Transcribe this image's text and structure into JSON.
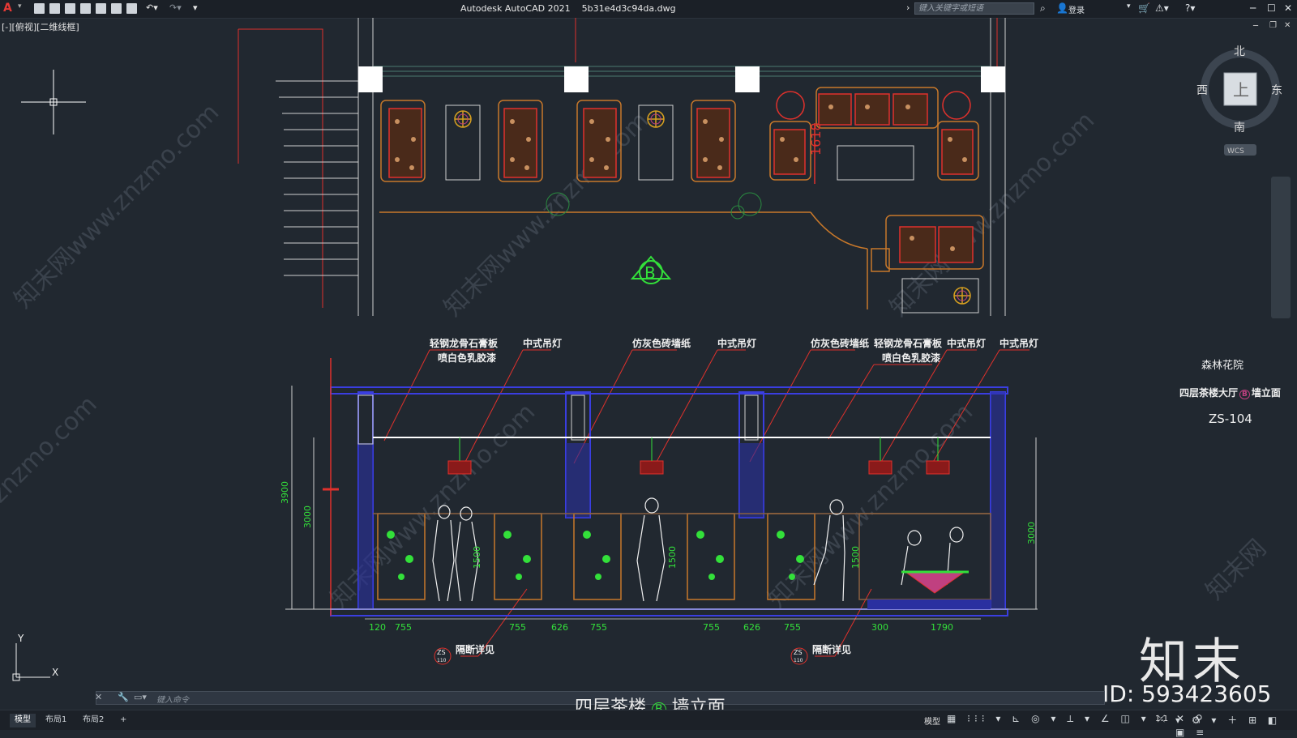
{
  "window": {
    "app_title": "Autodesk AutoCAD 2021",
    "file_name": "5b31e4d3c94da.dwg",
    "search_placeholder": "键入关键字或短语",
    "login_label": "登录"
  },
  "viewport": {
    "view_label": "[-][俯视][二维线框]"
  },
  "viewcube": {
    "north": "北",
    "south": "南",
    "east": "东",
    "west": "西",
    "face": "上",
    "wcs": "WCS"
  },
  "title_block": {
    "project": "森林花院",
    "sheet_title": "四层茶楼大厅",
    "sheet_suffix": "墙立面",
    "elevation_mark": "B",
    "sheet_no": "ZS-104"
  },
  "plan": {
    "elevation_marker": "B",
    "dimension": "1618"
  },
  "annotations": [
    {
      "text": "轻钢龙骨石膏板",
      "text2": "喷白色乳胶漆"
    },
    {
      "text": "中式吊灯"
    },
    {
      "text": "仿灰色砖墙纸"
    },
    {
      "text": "中式吊灯"
    },
    {
      "text": "仿灰色砖墙纸"
    },
    {
      "text": "轻钢龙骨石膏板",
      "text2": "喷白色乳胶漆"
    },
    {
      "text": "中式吊灯"
    },
    {
      "text": "中式吊灯"
    }
  ],
  "elevation": {
    "dim_left_outer": "3900",
    "dim_left_inner": "3000",
    "dim_right": "3000",
    "dim_1500_labels": [
      "1500",
      "1500",
      "1500"
    ],
    "bottom_dims": [
      "120",
      "755",
      "755",
      "626",
      "755",
      "755",
      "626",
      "755",
      "300",
      "1790"
    ],
    "detail_refs": [
      {
        "code": "ZS",
        "num": "110",
        "label": "隔断详见"
      },
      {
        "code": "ZS",
        "num": "110",
        "label": "隔断详见"
      }
    ],
    "drawing_title": "四层茶楼",
    "drawing_title_mark": "B",
    "drawing_title_suffix": "墙立面"
  },
  "ucs": {
    "x": "X",
    "y": "Y"
  },
  "command": {
    "placeholder": "键入命令"
  },
  "layout_tabs": [
    "模型",
    "布局1",
    "布局2",
    "+"
  ],
  "status": {
    "model_label": "模型",
    "scale": "1:1"
  },
  "watermark": {
    "logo": "知末",
    "id": "ID: 593423605",
    "url": "znzmo.com"
  },
  "colors": {
    "background": "#212830",
    "furniture": "#c8782a",
    "red": "#e0312c",
    "green": "#33e03a",
    "blue": "#3a3ee0",
    "text": "#f0f0f0"
  }
}
